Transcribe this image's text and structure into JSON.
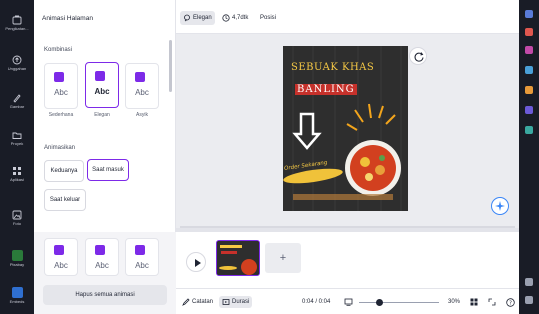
{
  "rail": {
    "items": [
      {
        "label": "Pengikatan..."
      },
      {
        "label": "Unggahan"
      },
      {
        "label": "Gambar"
      },
      {
        "label": "Proyek"
      },
      {
        "label": "Aplikasi"
      },
      {
        "label": "Foto"
      },
      {
        "label": "Pixabay"
      },
      {
        "label": "Embeds"
      }
    ]
  },
  "panel": {
    "title": "Animasi Halaman",
    "combination_label": "Kombinasi",
    "combination_cards": [
      {
        "caption": "Sederhana",
        "preview": "Abc"
      },
      {
        "caption": "Elegan",
        "preview": "Abc"
      },
      {
        "caption": "Asyik",
        "preview": "Abc"
      }
    ],
    "animation_label": "Animasikan",
    "animation_options": [
      "Keduanya",
      "Saat masuk",
      "Saat keluar"
    ],
    "more_cards": [
      {
        "preview": "Abc"
      },
      {
        "preview": "Abc"
      },
      {
        "preview": "Abc"
      }
    ],
    "remove_all_label": "Hapus semua animasi"
  },
  "toolbar": {
    "animation_label": "Elegan",
    "duration_label": "4,7dtk",
    "position_label": "Posisi"
  },
  "design": {
    "headline1": "SEBUAK KHAS",
    "headline2": "BANLING",
    "cta": "Order Sekarang"
  },
  "bottom": {
    "notes_label": "Catatan",
    "duration_label": "Durasi",
    "time_readout": "0:04 / 0:04",
    "zoom_percent": "30%",
    "zoom_value": 0.3
  },
  "colors": {
    "accent": "#7d2ae8",
    "rail_bg": "#191c26",
    "workspace_bg": "#ebecf0",
    "info_blue": "#3a86f7"
  }
}
